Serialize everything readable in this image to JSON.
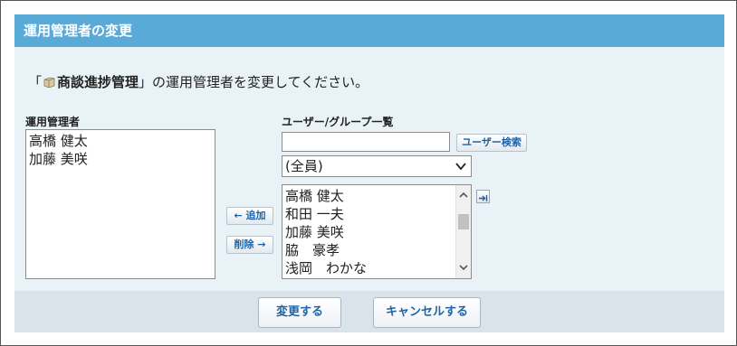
{
  "dialog": {
    "title": "運用管理者の変更",
    "intro_open": "「",
    "app_name": "商談進捗管理",
    "intro_close": "」の運用管理者を変更してください。"
  },
  "admins": {
    "label": "運用管理者",
    "items": [
      "高橋 健太",
      "加藤 美咲"
    ]
  },
  "users": {
    "label": "ユーザー/グループ一覧",
    "search_value": "",
    "search_button": "ユーザー検索",
    "group_selected": "(全員)",
    "items": [
      "高橋 健太",
      "和田 一夫",
      "加藤 美咲",
      "脇　豪孝",
      "浅岡　わかな"
    ]
  },
  "actions": {
    "add": "← 追加",
    "remove": "削除 →"
  },
  "footer": {
    "submit": "変更する",
    "cancel": "キャンセルする"
  },
  "colors": {
    "title_bar": "#5aaad8",
    "panel_bg": "#e9f2f6",
    "footer_bg": "#dbe3ea",
    "link_text": "#1e63a6"
  },
  "icons": [
    "app-icon",
    "chevron-down-icon",
    "scroll-up-icon",
    "scroll-down-icon",
    "move-to-end-icon"
  ]
}
